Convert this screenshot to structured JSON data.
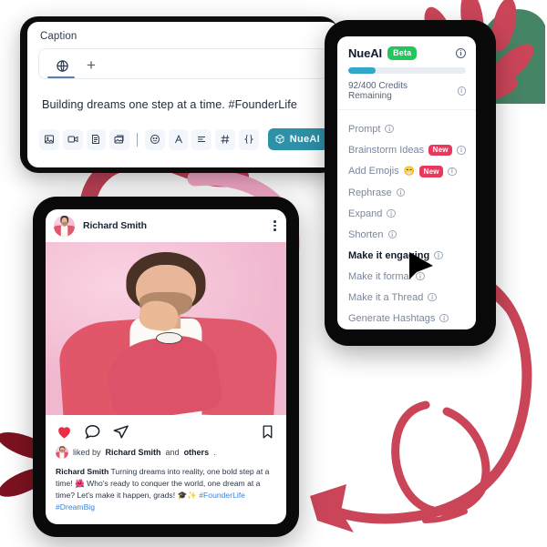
{
  "colors": {
    "accent_teal": "#2d91a8",
    "badge_green": "#22c55e",
    "badge_new_red": "#e8395c",
    "deco_crimson": "#cb4559",
    "deco_dark_red": "#7d1220",
    "deco_pink": "#f4a8c8",
    "link_blue": "#3b82d6",
    "device_black": "#0a0a0a",
    "progress_fill": "#31a8c9"
  },
  "caption_panel": {
    "label": "Caption",
    "tabs": {
      "globe_icon": "globe-icon",
      "add_icon": "plus-icon"
    },
    "text": "Building dreams one step at a time. #FounderLife",
    "toolbar": {
      "items": [
        {
          "icon": "image-icon",
          "name": "insert-image"
        },
        {
          "icon": "video-icon",
          "name": "insert-video"
        },
        {
          "icon": "document-icon",
          "name": "insert-document"
        },
        {
          "icon": "gallery-icon",
          "name": "insert-gallery"
        },
        {
          "icon": "divider",
          "name": "toolbar-divider"
        },
        {
          "icon": "emoji-icon",
          "name": "insert-emoji"
        },
        {
          "icon": "font-icon",
          "name": "text-style"
        },
        {
          "icon": "align-icon",
          "name": "text-align"
        },
        {
          "icon": "hashtag-icon",
          "name": "insert-hashtag"
        },
        {
          "icon": "braces-icon",
          "name": "insert-variable"
        }
      ],
      "nueai_label": "NueAI",
      "nueai_icon": "cube-icon"
    }
  },
  "ai_panel": {
    "title": "NueAI",
    "beta_badge": "Beta",
    "info_icon": "info-icon",
    "credits_text": "92/400 Credits Remaining",
    "credits_used": 92,
    "credits_total": 400,
    "progress_percent": 23,
    "menu": [
      {
        "label": "Prompt",
        "badge": null,
        "emoji": null,
        "active": false
      },
      {
        "label": "Brainstorm Ideas",
        "badge": "New",
        "emoji": null,
        "active": false
      },
      {
        "label": "Add Emojis",
        "badge": "New",
        "emoji": "😁",
        "active": false
      },
      {
        "label": "Rephrase",
        "badge": null,
        "emoji": null,
        "active": false
      },
      {
        "label": "Expand",
        "badge": null,
        "emoji": null,
        "active": false
      },
      {
        "label": "Shorten",
        "badge": null,
        "emoji": null,
        "active": false
      },
      {
        "label": "Make it engaging",
        "badge": null,
        "emoji": null,
        "active": true
      },
      {
        "label": "Make it formal",
        "badge": null,
        "emoji": null,
        "active": false
      },
      {
        "label": "Make it a Thread",
        "badge": null,
        "emoji": null,
        "active": false
      },
      {
        "label": "Generate Hashtags",
        "badge": null,
        "emoji": null,
        "active": false
      }
    ]
  },
  "post": {
    "username": "Richard Smith",
    "menu_icon": "kebab-menu-icon",
    "avatar": "user-avatar",
    "photo": "man-in-pink-blazer-photo",
    "actions": {
      "like_icon": "heart-icon",
      "comment_icon": "comment-icon",
      "share_icon": "share-icon",
      "save_icon": "bookmark-icon"
    },
    "likes_prefix": "liked by",
    "likes_name": "Richard Smith",
    "likes_middle": "and",
    "likes_others": "others",
    "likes_suffix": ".",
    "caption_author": "Richard Smith",
    "caption_line1": " Turning dreams into reality, one bold step at a time! 🌺 Who's ready to conquer the world, one dream at a time? Let's make it happen, grads! 🎓✨ ",
    "caption_tags": "#FounderLife #DreamBig"
  },
  "cursor": {
    "icon": "mouse-pointer-icon"
  }
}
